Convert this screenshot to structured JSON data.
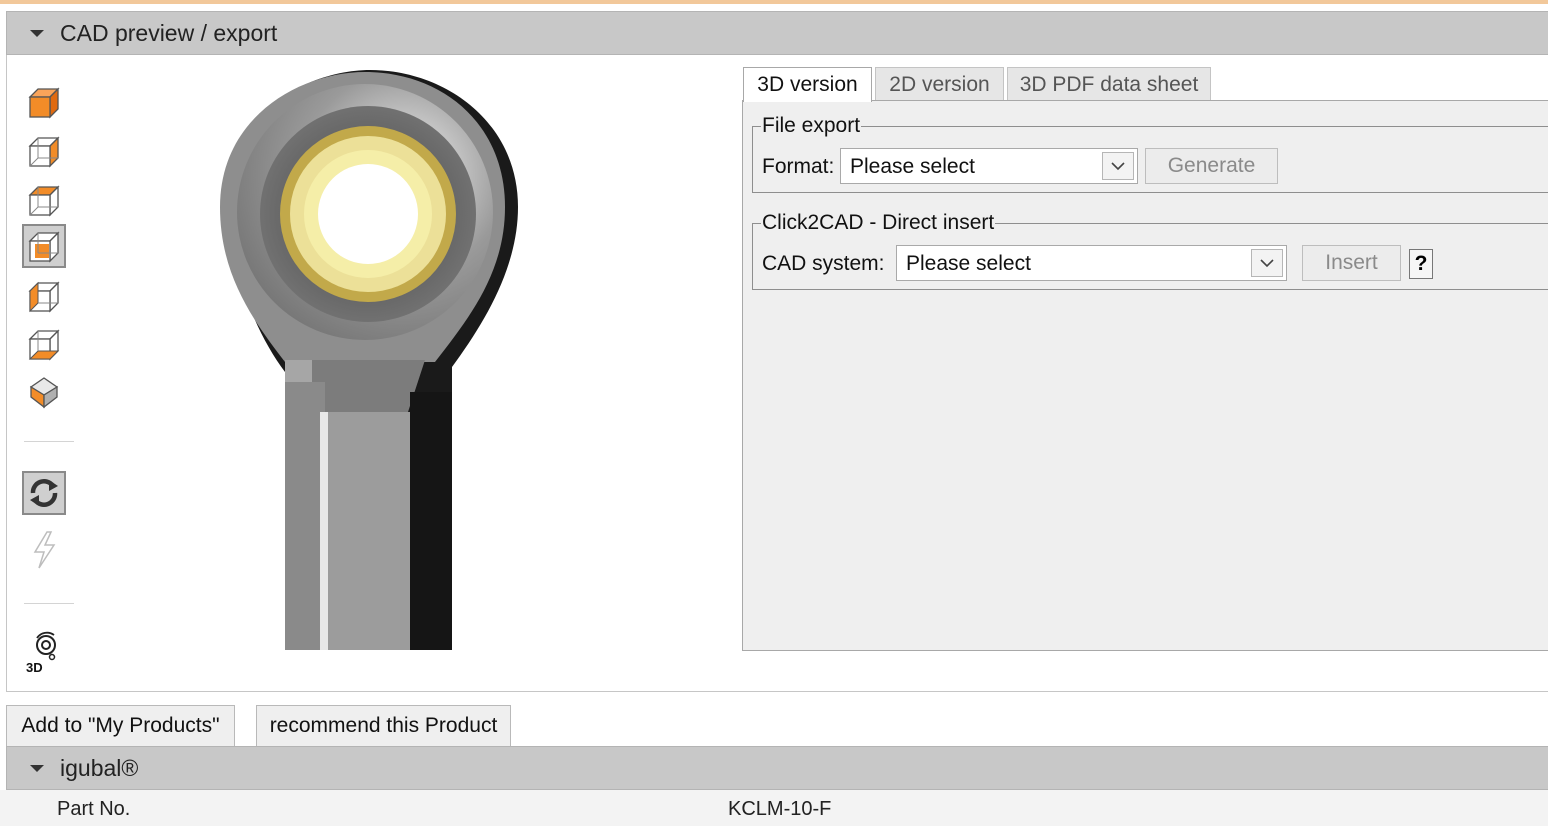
{
  "cad_section": {
    "title": "CAD preview / export"
  },
  "toolbar": {
    "view_icons": [
      "isometric-view-icon",
      "front-view-icon",
      "top-view-icon",
      "right-view-icon",
      "left-view-icon",
      "bottom-view-icon",
      "shaded-view-icon"
    ],
    "rotate_icon": "rotate-icon",
    "flash_icon": "lightning-icon",
    "orbit_icon": "3d-orbit-icon",
    "orbit_label": "3D"
  },
  "tabs": [
    {
      "label": "3D version",
      "active": true
    },
    {
      "label": "2D version",
      "active": false
    },
    {
      "label": "3D PDF data sheet",
      "active": false
    }
  ],
  "file_export": {
    "legend": "File export",
    "format_label": "Format:",
    "format_value": "Please select",
    "generate_label": "Generate"
  },
  "click2cad": {
    "legend": "Click2CAD - Direct insert",
    "cad_system_label": "CAD system:",
    "cad_system_value": "Please select",
    "insert_label": "Insert",
    "help_label": "?"
  },
  "actions": {
    "add_label": "Add to \"My Products\"",
    "recommend_label": "recommend this Product"
  },
  "igubal_section": {
    "title": "igubal®"
  },
  "specs": [
    {
      "key": "Part No.",
      "value": "KCLM-10-F"
    }
  ],
  "colors": {
    "accent_orange": "#f28c28",
    "header_gray": "#c8c8c8",
    "panel_bg": "#efefef"
  }
}
